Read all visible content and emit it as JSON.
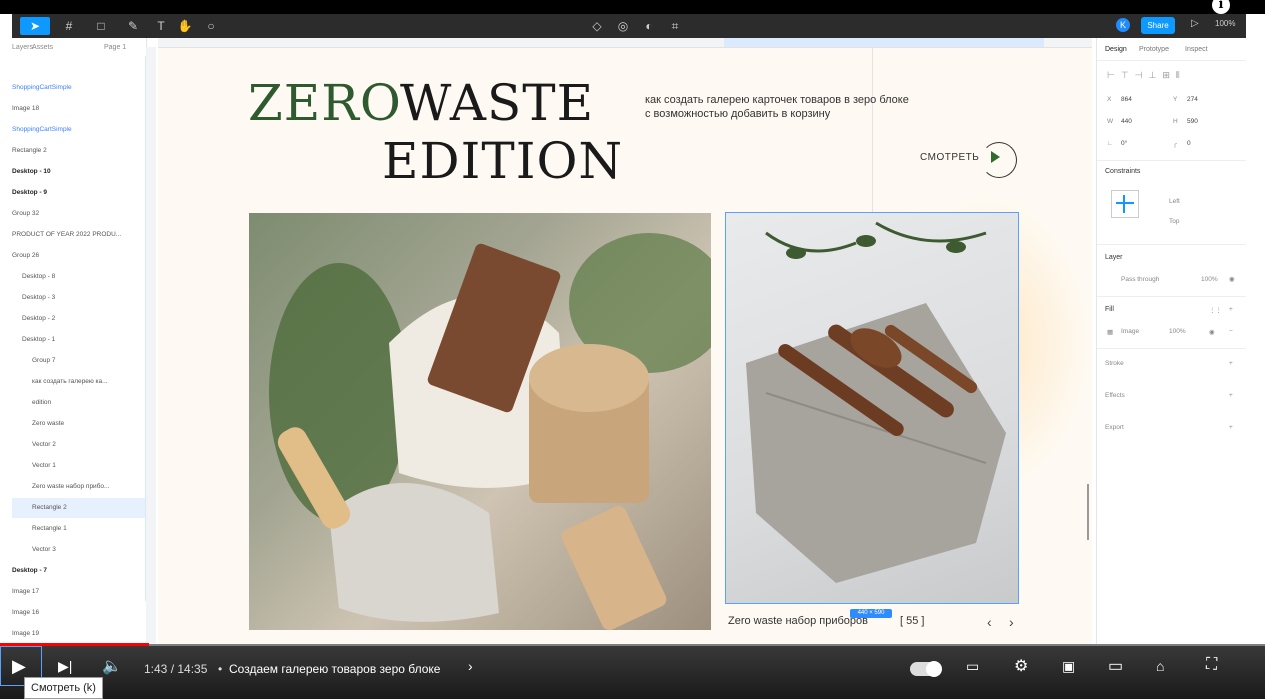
{
  "figma": {
    "toolbar": {
      "share_label": "Share",
      "avatar_letter": "K",
      "zoom": "100%"
    },
    "left_panel": {
      "tab_layers": "Layers",
      "tab_assets": "Assets",
      "page_label": "Page 1",
      "layers": [
        {
          "label": "ShoppingCartSimple",
          "style": "link",
          "indent": 0
        },
        {
          "label": "Image 18",
          "style": "normal",
          "indent": 0
        },
        {
          "label": "ShoppingCartSimple",
          "style": "link",
          "indent": 0
        },
        {
          "label": "Rectangle 2",
          "style": "normal",
          "indent": 0
        },
        {
          "label": "Desktop - 10",
          "style": "bold",
          "indent": 0
        },
        {
          "label": "Desktop - 9",
          "style": "bold",
          "indent": 0
        },
        {
          "label": "Group 32",
          "style": "normal",
          "indent": 0
        },
        {
          "label": "PRODUCT OF YEAR 2022 PRODU...",
          "style": "normal",
          "indent": 0
        },
        {
          "label": "Group 26",
          "style": "normal",
          "indent": 0
        },
        {
          "label": "Desktop - 8",
          "style": "normal",
          "indent": 1
        },
        {
          "label": "Desktop - 3",
          "style": "normal",
          "indent": 1
        },
        {
          "label": "Desktop - 2",
          "style": "normal",
          "indent": 1
        },
        {
          "label": "Desktop - 1",
          "style": "normal",
          "indent": 1
        },
        {
          "label": "Group 7",
          "style": "normal",
          "indent": 2
        },
        {
          "label": "как создать галерею ка...",
          "style": "normal",
          "indent": 2
        },
        {
          "label": "edition",
          "style": "normal",
          "indent": 2
        },
        {
          "label": "Zero waste",
          "style": "normal",
          "indent": 2
        },
        {
          "label": "Vector 2",
          "style": "normal",
          "indent": 2
        },
        {
          "label": "Vector 1",
          "style": "normal",
          "indent": 2
        },
        {
          "label": "Zero waste набор прибо...",
          "style": "normal",
          "indent": 2
        },
        {
          "label": "Rectangle 2",
          "style": "selected",
          "indent": 2
        },
        {
          "label": "Rectangle 1",
          "style": "normal",
          "indent": 2
        },
        {
          "label": "Vector 3",
          "style": "normal",
          "indent": 2
        },
        {
          "label": "Desktop - 7",
          "style": "bold",
          "indent": 0
        },
        {
          "label": "Image 17",
          "style": "normal",
          "indent": 0
        },
        {
          "label": "Image 16",
          "style": "normal",
          "indent": 0
        },
        {
          "label": "Image 19",
          "style": "normal",
          "indent": 0
        }
      ]
    },
    "canvas": {
      "title_zero": "ZERO",
      "title_waste": "WASTE",
      "title_edition": "EDITION",
      "description_line1": "как создать галерею карточек товаров в зеро блоке",
      "description_line2": "с возможностью добавить в корзину",
      "watch_label": "СМОТРЕТЬ",
      "product_name": "Zero waste набор приборов",
      "product_price": "[ 55 ]",
      "selection_size": "440 × 590",
      "arrow_prev": "‹",
      "arrow_next": "›"
    },
    "right_panel": {
      "tab_design": "Design",
      "tab_prototype": "Prototype",
      "tab_inspect": "Inspect",
      "x_label": "X",
      "x_value": "864",
      "y_label": "Y",
      "y_value": "274",
      "w_label": "W",
      "w_value": "440",
      "h_label": "H",
      "h_value": "590",
      "rotation_value": "0°",
      "radius_value": "0",
      "constraints_title": "Constraints",
      "constraint_h": "Left",
      "constraint_v": "Top",
      "layer_title": "Layer",
      "layer_mode": "Pass through",
      "layer_opacity": "100%",
      "fill_title": "Fill",
      "fill_type": "Image",
      "fill_opacity": "100%",
      "stroke_title": "Stroke",
      "effects_title": "Effects",
      "export_title": "Export"
    }
  },
  "player": {
    "time": "1:43 / 14:35",
    "separator": "•",
    "chapter": "Создаем галерею товаров зеро блоке",
    "tooltip": "Смотреть (k)",
    "progress_fraction": 0.1177
  },
  "colors": {
    "figma_blue": "#0d99ff",
    "zero_green": "#2f5a2f",
    "progress_red": "#ff0000"
  }
}
